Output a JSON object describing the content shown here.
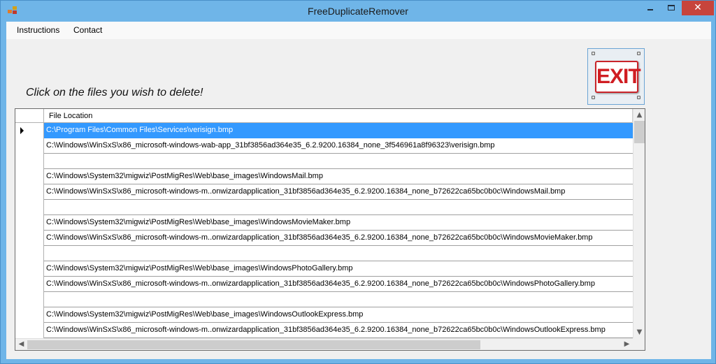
{
  "window": {
    "title": "FreeDuplicateRemover",
    "close_glyph": "✕",
    "minimize_icon": "minimize-icon",
    "maximize_icon": "maximize-icon",
    "close_icon": "close-icon"
  },
  "menu": {
    "items": [
      {
        "label": "Instructions"
      },
      {
        "label": "Contact"
      }
    ]
  },
  "main": {
    "instructions": "Click on the files you wish to delete!",
    "exit_label": "EXIT",
    "exit_color": "#d01d22"
  },
  "grid": {
    "column_header": "File Location",
    "selected_color": "#3399ff",
    "rows": [
      {
        "text": "C:\\Program Files\\Common Files\\Services\\verisign.bmp",
        "selected": true
      },
      {
        "text": "C:\\Windows\\WinSxS\\x86_microsoft-windows-wab-app_31bf3856ad364e35_6.2.9200.16384_none_3f546961a8f96323\\verisign.bmp",
        "selected": false
      },
      {
        "text": "",
        "selected": false
      },
      {
        "text": "C:\\Windows\\System32\\migwiz\\PostMigRes\\Web\\base_images\\WindowsMail.bmp",
        "selected": false
      },
      {
        "text": "C:\\Windows\\WinSxS\\x86_microsoft-windows-m..onwizardapplication_31bf3856ad364e35_6.2.9200.16384_none_b72622ca65bc0b0c\\WindowsMail.bmp",
        "selected": false
      },
      {
        "text": "",
        "selected": false
      },
      {
        "text": "C:\\Windows\\System32\\migwiz\\PostMigRes\\Web\\base_images\\WindowsMovieMaker.bmp",
        "selected": false
      },
      {
        "text": "C:\\Windows\\WinSxS\\x86_microsoft-windows-m..onwizardapplication_31bf3856ad364e35_6.2.9200.16384_none_b72622ca65bc0b0c\\WindowsMovieMaker.bmp",
        "selected": false
      },
      {
        "text": "",
        "selected": false
      },
      {
        "text": "C:\\Windows\\System32\\migwiz\\PostMigRes\\Web\\base_images\\WindowsPhotoGallery.bmp",
        "selected": false
      },
      {
        "text": "C:\\Windows\\WinSxS\\x86_microsoft-windows-m..onwizardapplication_31bf3856ad364e35_6.2.9200.16384_none_b72622ca65bc0b0c\\WindowsPhotoGallery.bmp",
        "selected": false
      },
      {
        "text": "",
        "selected": false
      },
      {
        "text": "C:\\Windows\\System32\\migwiz\\PostMigRes\\Web\\base_images\\WindowsOutlookExpress.bmp",
        "selected": false
      },
      {
        "text": "C:\\Windows\\WinSxS\\x86_microsoft-windows-m..onwizardapplication_31bf3856ad364e35_6.2.9200.16384_none_b72622ca65bc0b0c\\WindowsOutlookExpress.bmp",
        "selected": false
      }
    ],
    "scroll_up": "▲",
    "scroll_down": "▼",
    "scroll_left": "◀",
    "scroll_right": "▶"
  }
}
